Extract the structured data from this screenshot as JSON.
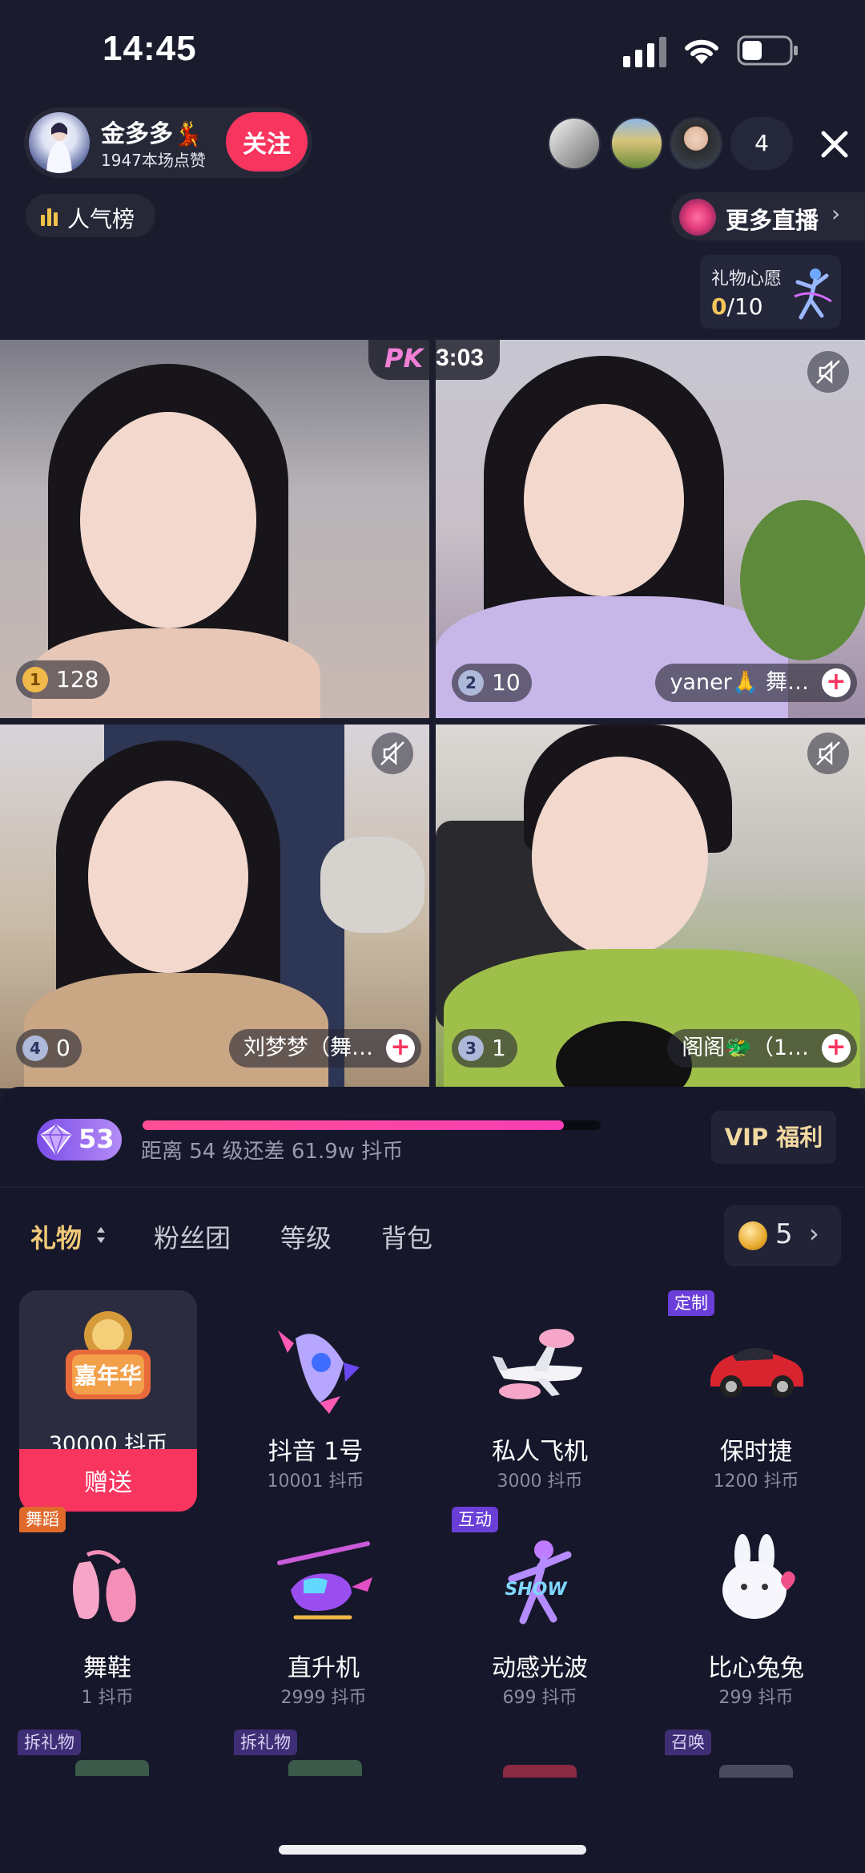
{
  "status_bar": {
    "time": "14:45"
  },
  "host": {
    "name": "金多多💃",
    "likes": "1947本场点赞",
    "follow_label": "关注"
  },
  "viewers": {
    "count": "4"
  },
  "rank": {
    "label": "人气榜"
  },
  "more_live": {
    "label": "更多直播",
    "chevron": "›"
  },
  "wish": {
    "label": "礼物心愿",
    "current": "0",
    "total": "/10"
  },
  "pk": {
    "logo": "PK",
    "timer": "3:03"
  },
  "streams": [
    {
      "rank_badge": "1",
      "score": "128",
      "name": "",
      "badge_color": "#f1b84a"
    },
    {
      "rank_badge": "2",
      "score": "10",
      "name": "yaner🙏 舞…",
      "badge_color": "#aeb8d8"
    },
    {
      "rank_badge": "4",
      "score": "0",
      "name": "刘梦梦（舞…",
      "badge_color": "#aeb8d8"
    },
    {
      "rank_badge": "3",
      "score": "1",
      "name": "阁阁🐲（1…",
      "badge_color": "#aeb8d8"
    }
  ],
  "level": {
    "value": "53",
    "progress": 0.92,
    "text": "距离 54 级还差 61.9w 抖币",
    "vip_label": "VIP 福利"
  },
  "tabs": [
    "礼物",
    "粉丝团",
    "等级",
    "背包"
  ],
  "balance": {
    "value": "5",
    "chevron": "›"
  },
  "gifts": [
    {
      "name": "嘉年华",
      "price": "30000 抖币",
      "tag": "",
      "send_label": "赠送",
      "selected": true
    },
    {
      "name": "抖音 1号",
      "price": "10001 抖币",
      "tag": ""
    },
    {
      "name": "私人飞机",
      "price": "3000 抖币",
      "tag": ""
    },
    {
      "name": "保时捷",
      "price": "1200 抖币",
      "tag": "定制"
    },
    {
      "name": "舞鞋",
      "price": "1 抖币",
      "tag": "舞蹈"
    },
    {
      "name": "直升机",
      "price": "2999 抖币",
      "tag": ""
    },
    {
      "name": "动感光波",
      "price": "699 抖币",
      "tag": "互动"
    },
    {
      "name": "比心兔兔",
      "price": "299 抖币",
      "tag": ""
    }
  ],
  "row3_tags": [
    "拆礼物",
    "拆礼物",
    "召唤"
  ],
  "colors": {
    "accent": "#f7355f",
    "gold": "#f0c979",
    "panel": "#16172a",
    "bg": "#1a1c2e"
  }
}
